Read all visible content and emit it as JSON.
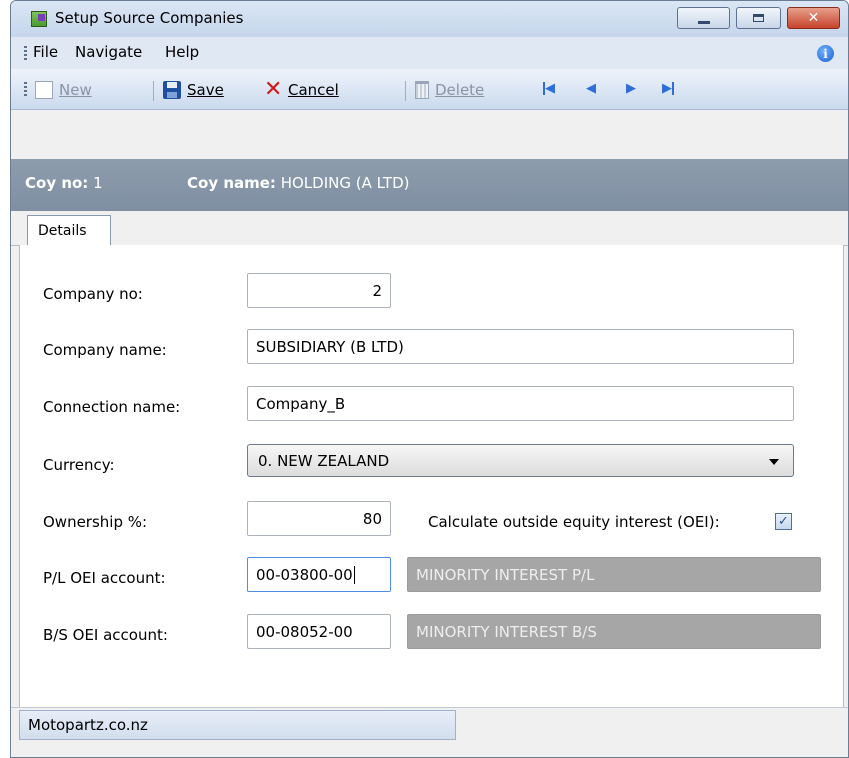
{
  "window": {
    "title": "Setup Source Companies"
  },
  "menu": {
    "items": [
      "File",
      "Navigate",
      "Help"
    ]
  },
  "toolbar": {
    "new_label": "New",
    "save_label": "Save",
    "cancel_label": "Cancel",
    "delete_label": "Delete"
  },
  "header": {
    "coy_no_label": "Coy no:",
    "coy_no_value": "1",
    "coy_name_label": "Coy name:",
    "coy_name_value": "HOLDING (A LTD)"
  },
  "tabs": [
    {
      "label": "Details"
    }
  ],
  "form": {
    "company_no": {
      "label": "Company no:",
      "value": "2"
    },
    "company_name": {
      "label": "Company name:",
      "value": "SUBSIDIARY (B LTD)"
    },
    "connection_name": {
      "label": "Connection name:",
      "value": "Company_B"
    },
    "currency": {
      "label": "Currency:",
      "value": "0. NEW ZEALAND"
    },
    "ownership": {
      "label": "Ownership %:",
      "value": "80"
    },
    "calc_oei": {
      "label": "Calculate outside equity interest (OEI):",
      "checked": true
    },
    "pl_oei": {
      "label": "P/L OEI account:",
      "value": "00-03800-00",
      "description": "MINORITY INTEREST P/L"
    },
    "bs_oei": {
      "label": "B/S OEI account:",
      "value": "00-08052-00",
      "description": "MINORITY INTEREST B/S"
    }
  },
  "status": {
    "text": "Motopartz.co.nz"
  },
  "icons": [
    "app-icon",
    "info-icon",
    "new-icon",
    "save-icon",
    "cancel-icon",
    "delete-icon",
    "first-icon",
    "previous-icon",
    "next-icon",
    "last-icon",
    "checkmark-icon"
  ]
}
